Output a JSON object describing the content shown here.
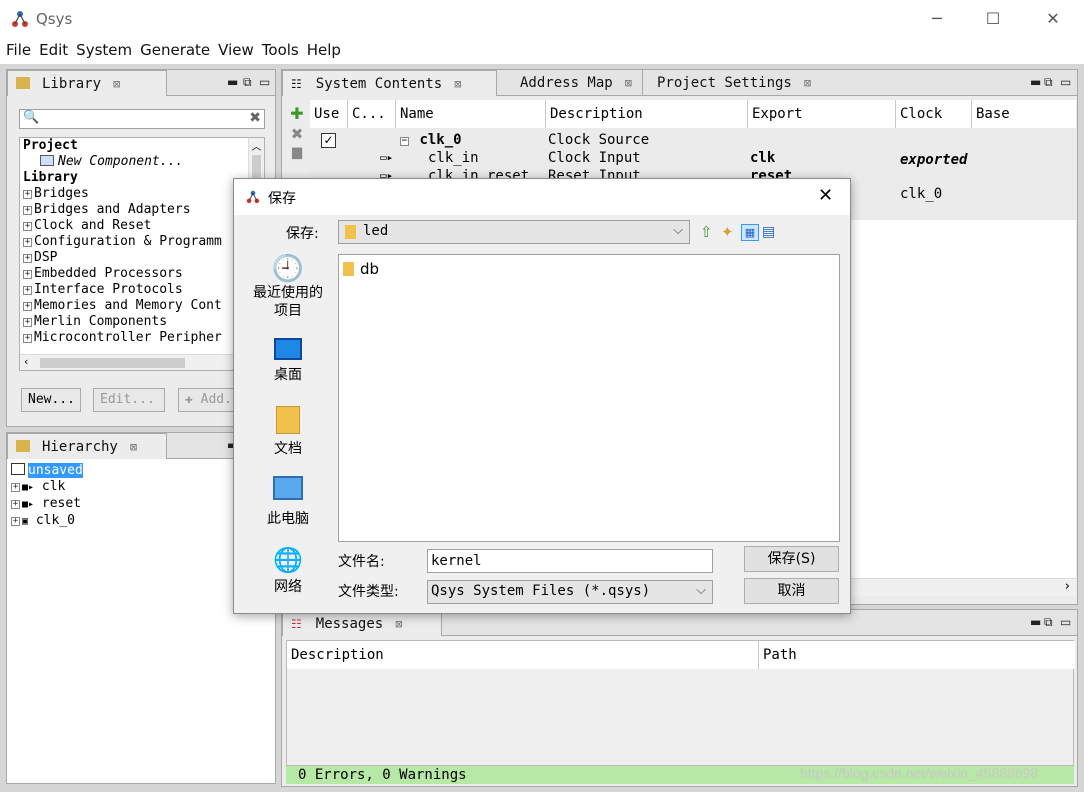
{
  "window": {
    "title": "Qsys",
    "minimize": "─",
    "maximize": "☐",
    "close": "✕"
  },
  "menu": [
    "File",
    "Edit",
    "System",
    "Generate",
    "View",
    "Tools",
    "Help"
  ],
  "library": {
    "tab_label": "Library",
    "search_placeholder": "",
    "project_heading": "Project",
    "new_component": "New Component...",
    "library_heading": "Library",
    "items": [
      "Bridges",
      "Bridges and Adapters",
      "Clock and Reset",
      "Configuration & Programm",
      "DSP",
      "Embedded Processors",
      "Interface Protocols",
      "Memories and Memory Cont",
      "Merlin Components",
      "Microcontroller Peripher"
    ],
    "buttons": {
      "new": "New...",
      "edit": "Edit...",
      "add": "Add..."
    }
  },
  "hierarchy": {
    "tab_label": "Hierarchy",
    "root": "unsaved",
    "items": [
      "clk",
      "reset",
      "clk_0"
    ]
  },
  "system": {
    "tabs": [
      "System Contents",
      "Address Map",
      "Project Settings"
    ],
    "columns": [
      "Use",
      "C...",
      "Name",
      "Description",
      "Export",
      "Clock",
      "Base"
    ],
    "rows": [
      {
        "name": "clk_0",
        "description": "Clock Source",
        "export": "",
        "clock": ""
      },
      {
        "name": "clk_in",
        "description": "Clock Input",
        "export": "clk",
        "clock": "exported"
      },
      {
        "name": "clk_in_reset",
        "description": "Reset Input",
        "export": "reset",
        "clock": ""
      },
      {
        "name": "",
        "description": "",
        "export": "",
        "clock": "clk_0"
      }
    ]
  },
  "messages": {
    "tab_label": "Messages",
    "columns": [
      "Description",
      "Path"
    ],
    "status": "0 Errors, 0 Warnings"
  },
  "watermark": "https://blog.csdn.net/weixin_45888898",
  "dialog": {
    "title": "保存",
    "save_in_label": "保存:",
    "folder": "led",
    "places": [
      "最近使用的\n项目",
      "桌面",
      "文档",
      "此电脑",
      "网络"
    ],
    "files": [
      "db"
    ],
    "filename_label": "文件名:",
    "filename": "kernel",
    "filetype_label": "文件类型:",
    "filetype": "Qsys System Files (*.qsys)",
    "save_button": "保存(S)",
    "cancel_button": "取消"
  },
  "colors": {
    "status_bg": "#b6e8a6",
    "selection": "#3399ff"
  }
}
